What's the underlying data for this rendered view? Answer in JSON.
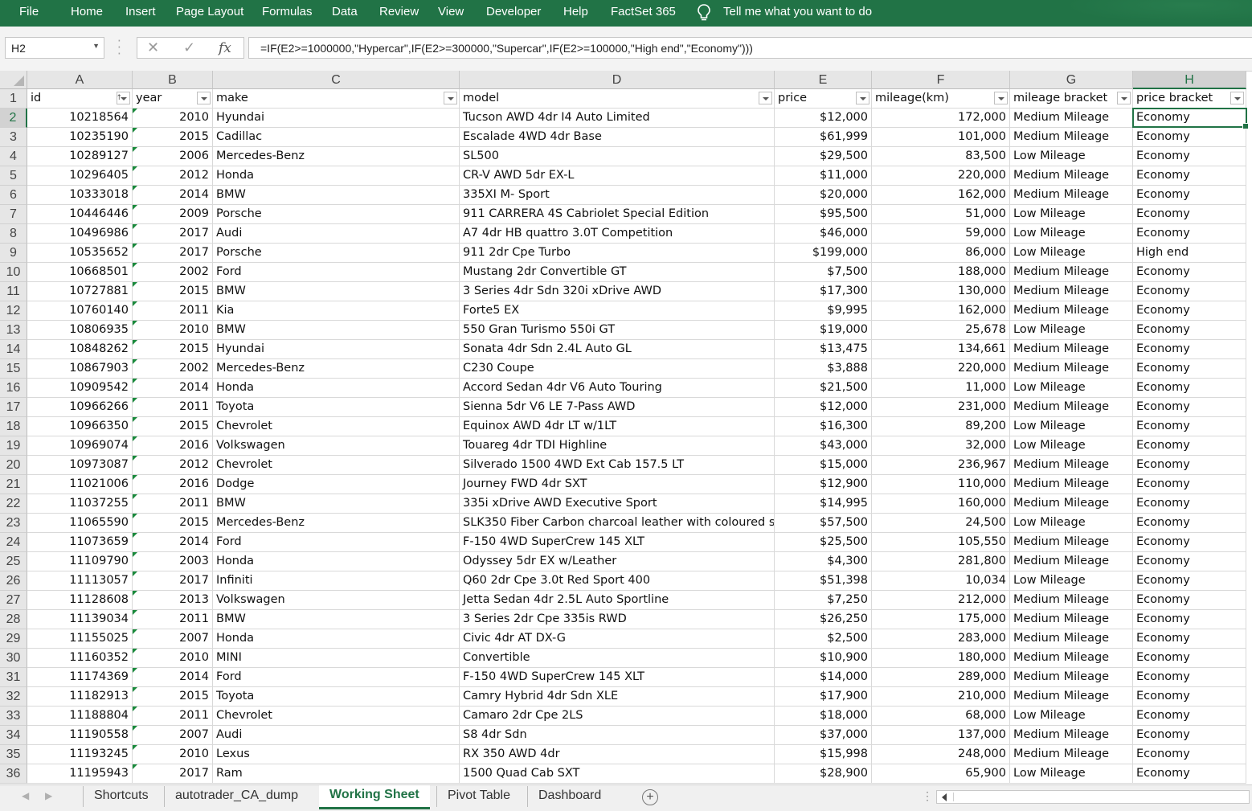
{
  "ribbon": {
    "tabs": [
      "File",
      "Home",
      "Insert",
      "Page Layout",
      "Formulas",
      "Data",
      "Review",
      "View",
      "Developer",
      "Help",
      "FactSet 365"
    ],
    "tell_me": "Tell me what you want to do"
  },
  "formula_bar": {
    "name_box": "H2",
    "formula": "=IF(E2>=1000000,\"Hypercar\",IF(E2>=300000,\"Supercar\",IF(E2>=100000,\"High end\",\"Economy\")))"
  },
  "columns": [
    "A",
    "B",
    "C",
    "D",
    "E",
    "F",
    "G",
    "H"
  ],
  "active_cell": {
    "column": "H",
    "row": "2"
  },
  "headers": [
    "id",
    "year",
    "make",
    "model",
    "price",
    "mileage(km)",
    "mileage bracket",
    "price bracket"
  ],
  "rows": [
    {
      "n": "2",
      "id": "10218564",
      "year": "2010",
      "make": "Hyundai",
      "model": "Tucson AWD 4dr I4 Auto Limited",
      "price": "$12,000",
      "mileage": "172,000",
      "mbracket": "Medium Mileage",
      "pbracket": "Economy"
    },
    {
      "n": "3",
      "id": "10235190",
      "year": "2015",
      "make": "Cadillac",
      "model": "Escalade 4WD 4dr Base",
      "price": "$61,999",
      "mileage": "101,000",
      "mbracket": "Medium Mileage",
      "pbracket": "Economy"
    },
    {
      "n": "4",
      "id": "10289127",
      "year": "2006",
      "make": "Mercedes-Benz",
      "model": "SL500",
      "price": "$29,500",
      "mileage": "83,500",
      "mbracket": "Low Mileage",
      "pbracket": "Economy"
    },
    {
      "n": "5",
      "id": "10296405",
      "year": "2012",
      "make": "Honda",
      "model": "CR-V AWD 5dr EX-L",
      "price": "$11,000",
      "mileage": "220,000",
      "mbracket": "Medium Mileage",
      "pbracket": "Economy"
    },
    {
      "n": "6",
      "id": "10333018",
      "year": "2014",
      "make": "BMW",
      "model": "335XI M- Sport",
      "price": "$20,000",
      "mileage": "162,000",
      "mbracket": "Medium Mileage",
      "pbracket": "Economy"
    },
    {
      "n": "7",
      "id": "10446446",
      "year": "2009",
      "make": "Porsche",
      "model": "911 CARRERA 4S Cabriolet Special Edition",
      "price": "$95,500",
      "mileage": "51,000",
      "mbracket": "Low Mileage",
      "pbracket": "Economy"
    },
    {
      "n": "8",
      "id": "10496986",
      "year": "2017",
      "make": "Audi",
      "model": "A7 4dr HB quattro 3.0T Competition",
      "price": "$46,000",
      "mileage": "59,000",
      "mbracket": "Low Mileage",
      "pbracket": "Economy"
    },
    {
      "n": "9",
      "id": "10535652",
      "year": "2017",
      "make": "Porsche",
      "model": "911 2dr Cpe Turbo",
      "price": "$199,000",
      "mileage": "86,000",
      "mbracket": "Low Mileage",
      "pbracket": "High end"
    },
    {
      "n": "10",
      "id": "10668501",
      "year": "2002",
      "make": "Ford",
      "model": "Mustang 2dr Convertible GT",
      "price": "$7,500",
      "mileage": "188,000",
      "mbracket": "Medium Mileage",
      "pbracket": "Economy"
    },
    {
      "n": "11",
      "id": "10727881",
      "year": "2015",
      "make": "BMW",
      "model": "3 Series 4dr Sdn 320i xDrive AWD",
      "price": "$17,300",
      "mileage": "130,000",
      "mbracket": "Medium Mileage",
      "pbracket": "Economy"
    },
    {
      "n": "12",
      "id": "10760140",
      "year": "2011",
      "make": "Kia",
      "model": "Forte5 EX",
      "price": "$9,995",
      "mileage": "162,000",
      "mbracket": "Medium Mileage",
      "pbracket": "Economy"
    },
    {
      "n": "13",
      "id": "10806935",
      "year": "2010",
      "make": "BMW",
      "model": "550 Gran Turismo 550i GT",
      "price": "$19,000",
      "mileage": "25,678",
      "mbracket": "Low Mileage",
      "pbracket": "Economy"
    },
    {
      "n": "14",
      "id": "10848262",
      "year": "2015",
      "make": "Hyundai",
      "model": "Sonata 4dr Sdn 2.4L Auto GL",
      "price": "$13,475",
      "mileage": "134,661",
      "mbracket": "Medium Mileage",
      "pbracket": "Economy"
    },
    {
      "n": "15",
      "id": "10867903",
      "year": "2002",
      "make": "Mercedes-Benz",
      "model": "C230 Coupe",
      "price": "$3,888",
      "mileage": "220,000",
      "mbracket": "Medium Mileage",
      "pbracket": "Economy"
    },
    {
      "n": "16",
      "id": "10909542",
      "year": "2014",
      "make": "Honda",
      "model": "Accord Sedan 4dr V6 Auto Touring",
      "price": "$21,500",
      "mileage": "11,000",
      "mbracket": "Low Mileage",
      "pbracket": "Economy"
    },
    {
      "n": "17",
      "id": "10966266",
      "year": "2011",
      "make": "Toyota",
      "model": "Sienna 5dr V6 LE 7-Pass AWD",
      "price": "$12,000",
      "mileage": "231,000",
      "mbracket": "Medium Mileage",
      "pbracket": "Economy"
    },
    {
      "n": "18",
      "id": "10966350",
      "year": "2015",
      "make": "Chevrolet",
      "model": "Equinox AWD 4dr LT w/1LT",
      "price": "$16,300",
      "mileage": "89,200",
      "mbracket": "Low Mileage",
      "pbracket": "Economy"
    },
    {
      "n": "19",
      "id": "10969074",
      "year": "2016",
      "make": "Volkswagen",
      "model": "Touareg 4dr TDI Highline",
      "price": "$43,000",
      "mileage": "32,000",
      "mbracket": "Low Mileage",
      "pbracket": "Economy"
    },
    {
      "n": "20",
      "id": "10973087",
      "year": "2012",
      "make": "Chevrolet",
      "model": "Silverado 1500 4WD Ext Cab 157.5 LT",
      "price": "$15,000",
      "mileage": "236,967",
      "mbracket": "Medium Mileage",
      "pbracket": "Economy"
    },
    {
      "n": "21",
      "id": "11021006",
      "year": "2016",
      "make": "Dodge",
      "model": "Journey FWD 4dr SXT",
      "price": "$12,900",
      "mileage": "110,000",
      "mbracket": "Medium Mileage",
      "pbracket": "Economy"
    },
    {
      "n": "22",
      "id": "11037255",
      "year": "2011",
      "make": "BMW",
      "model": "335i xDrive AWD Executive Sport",
      "price": "$14,995",
      "mileage": "160,000",
      "mbracket": "Medium Mileage",
      "pbracket": "Economy"
    },
    {
      "n": "23",
      "id": "11065590",
      "year": "2015",
      "make": "Mercedes-Benz",
      "model": "SLK350 Fiber Carbon charcoal leather with coloured s",
      "price": "$57,500",
      "mileage": "24,500",
      "mbracket": "Low Mileage",
      "pbracket": "Economy"
    },
    {
      "n": "24",
      "id": "11073659",
      "year": "2014",
      "make": "Ford",
      "model": "F-150 4WD SuperCrew 145 XLT",
      "price": "$25,500",
      "mileage": "105,550",
      "mbracket": "Medium Mileage",
      "pbracket": "Economy"
    },
    {
      "n": "25",
      "id": "11109790",
      "year": "2003",
      "make": "Honda",
      "model": "Odyssey 5dr EX w/Leather",
      "price": "$4,300",
      "mileage": "281,800",
      "mbracket": "Medium Mileage",
      "pbracket": "Economy"
    },
    {
      "n": "26",
      "id": "11113057",
      "year": "2017",
      "make": "Infiniti",
      "model": "Q60 2dr Cpe 3.0t Red Sport 400",
      "price": "$51,398",
      "mileage": "10,034",
      "mbracket": "Low Mileage",
      "pbracket": "Economy"
    },
    {
      "n": "27",
      "id": "11128608",
      "year": "2013",
      "make": "Volkswagen",
      "model": "Jetta Sedan 4dr 2.5L Auto Sportline",
      "price": "$7,250",
      "mileage": "212,000",
      "mbracket": "Medium Mileage",
      "pbracket": "Economy"
    },
    {
      "n": "28",
      "id": "11139034",
      "year": "2011",
      "make": "BMW",
      "model": "3 Series 2dr Cpe 335is RWD",
      "price": "$26,250",
      "mileage": "175,000",
      "mbracket": "Medium Mileage",
      "pbracket": "Economy"
    },
    {
      "n": "29",
      "id": "11155025",
      "year": "2007",
      "make": "Honda",
      "model": "Civic 4dr AT DX-G",
      "price": "$2,500",
      "mileage": "283,000",
      "mbracket": "Medium Mileage",
      "pbracket": "Economy"
    },
    {
      "n": "30",
      "id": "11160352",
      "year": "2010",
      "make": "MINI",
      "model": "Convertible",
      "price": "$10,900",
      "mileage": "180,000",
      "mbracket": "Medium Mileage",
      "pbracket": "Economy"
    },
    {
      "n": "31",
      "id": "11174369",
      "year": "2014",
      "make": "Ford",
      "model": "F-150 4WD SuperCrew 145 XLT",
      "price": "$14,000",
      "mileage": "289,000",
      "mbracket": "Medium Mileage",
      "pbracket": "Economy"
    },
    {
      "n": "32",
      "id": "11182913",
      "year": "2015",
      "make": "Toyota",
      "model": "Camry Hybrid 4dr Sdn XLE",
      "price": "$17,900",
      "mileage": "210,000",
      "mbracket": "Medium Mileage",
      "pbracket": "Economy"
    },
    {
      "n": "33",
      "id": "11188804",
      "year": "2011",
      "make": "Chevrolet",
      "model": "Camaro 2dr Cpe 2LS",
      "price": "$18,000",
      "mileage": "68,000",
      "mbracket": "Low Mileage",
      "pbracket": "Economy"
    },
    {
      "n": "34",
      "id": "11190558",
      "year": "2007",
      "make": "Audi",
      "model": "S8 4dr Sdn",
      "price": "$37,000",
      "mileage": "137,000",
      "mbracket": "Medium Mileage",
      "pbracket": "Economy"
    },
    {
      "n": "35",
      "id": "11193245",
      "year": "2010",
      "make": "Lexus",
      "model": "RX 350 AWD 4dr",
      "price": "$15,998",
      "mileage": "248,000",
      "mbracket": "Medium Mileage",
      "pbracket": "Economy"
    },
    {
      "n": "36",
      "id": "11195943",
      "year": "2017",
      "make": "Ram",
      "model": "1500 Quad Cab SXT",
      "price": "$28,900",
      "mileage": "65,900",
      "mbracket": "Low Mileage",
      "pbracket": "Economy"
    }
  ],
  "sheet_tabs": [
    "Shortcuts",
    "autotrader_CA_dump",
    "Working Sheet",
    "Pivot Table",
    "Dashboard"
  ],
  "active_sheet": "Working Sheet",
  "icons": {
    "bulb": "lightbulb-icon",
    "cancel": "cancel-x-icon",
    "enter": "checkmark-icon",
    "function": "fx-icon",
    "add_sheet": "plus-circle-icon"
  },
  "colors": {
    "accent": "#217346",
    "header_bg": "#e6e6e6",
    "error_triangle": "#1a8a3c"
  }
}
